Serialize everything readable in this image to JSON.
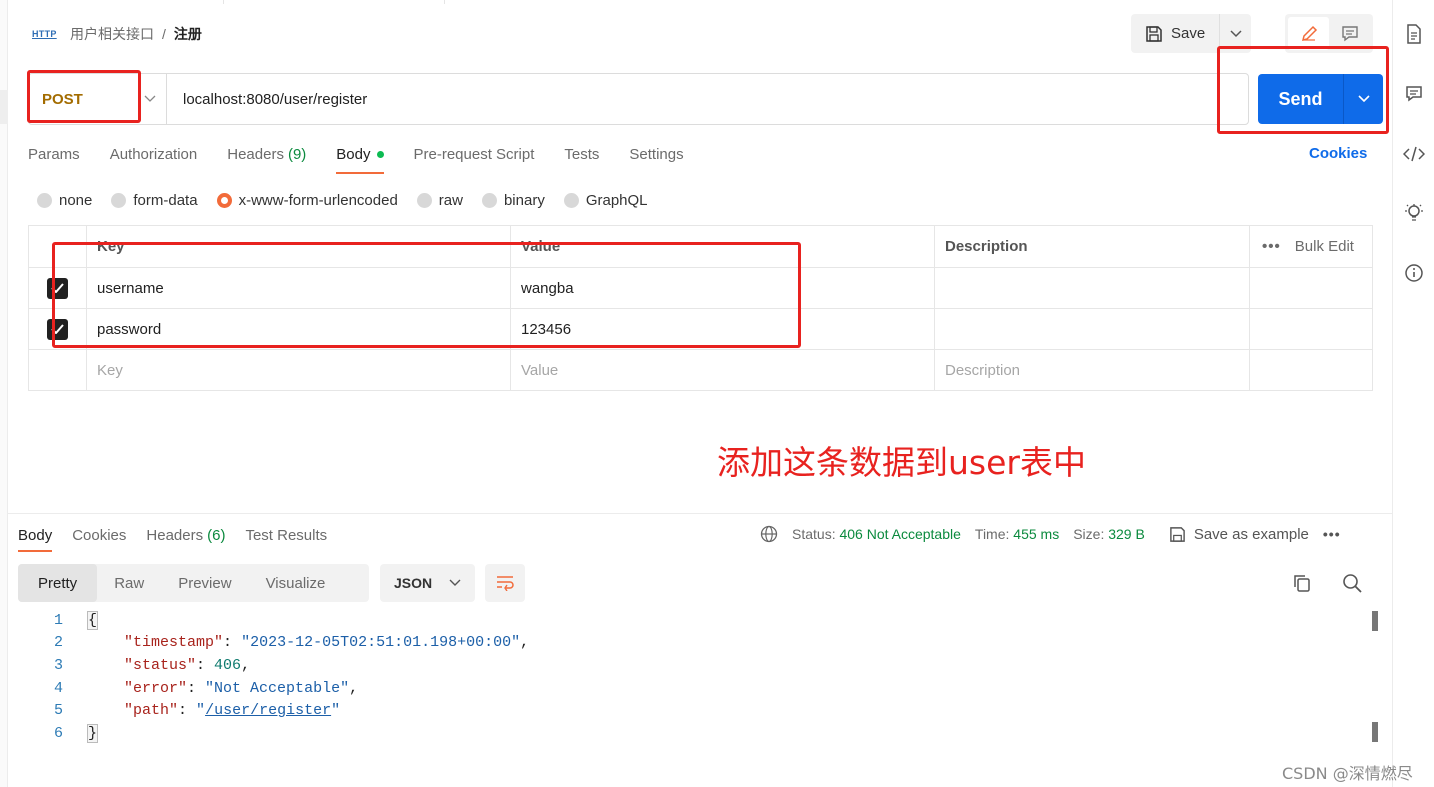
{
  "breadcrumb": {
    "icon": "HTTP",
    "parent": "用户相关接口",
    "separator": "/",
    "current": "注册"
  },
  "toolbar": {
    "save_label": "Save"
  },
  "request": {
    "method": "POST",
    "url": "localhost:8080/user/register",
    "send_label": "Send"
  },
  "tabs": [
    {
      "label": "Params"
    },
    {
      "label": "Authorization"
    },
    {
      "label": "Headers",
      "count": "(9)"
    },
    {
      "label": "Body"
    },
    {
      "label": "Pre-request Script"
    },
    {
      "label": "Tests"
    },
    {
      "label": "Settings"
    }
  ],
  "cookies_label": "Cookies",
  "body_types": [
    "none",
    "form-data",
    "x-www-form-urlencoded",
    "raw",
    "binary",
    "GraphQL"
  ],
  "body_type_selected": "x-www-form-urlencoded",
  "table": {
    "headers": {
      "key": "Key",
      "value": "Value",
      "description": "Description",
      "bulk_edit": "Bulk Edit"
    },
    "rows": [
      {
        "key": "username",
        "value": "wangba",
        "checked": true
      },
      {
        "key": "password",
        "value": "123456",
        "checked": true
      }
    ],
    "placeholders": {
      "key": "Key",
      "value": "Value",
      "description": "Description"
    }
  },
  "annotation": "添加这条数据到user表中",
  "response": {
    "tabs": [
      {
        "label": "Body"
      },
      {
        "label": "Cookies"
      },
      {
        "label": "Headers",
        "count": "(6)"
      },
      {
        "label": "Test Results"
      }
    ],
    "status_label": "Status:",
    "status_value": "406 Not Acceptable",
    "time_label": "Time:",
    "time_value": "455 ms",
    "size_label": "Size:",
    "size_value": "329 B",
    "save_example_label": "Save as example",
    "formats": [
      "Pretty",
      "Raw",
      "Preview",
      "Visualize"
    ],
    "format_selected": "Pretty",
    "language": "JSON"
  },
  "code_lines": [
    "1",
    "2",
    "3",
    "4",
    "5",
    "6"
  ],
  "json_body": {
    "timestamp_key": "\"timestamp\"",
    "timestamp_val": "\"2023-12-05T02:51:01.198+00:00\"",
    "status_key": "\"status\"",
    "status_val": "406",
    "error_key": "\"error\"",
    "error_val": "\"Not Acceptable\"",
    "path_key": "\"path\"",
    "path_val": "/user/register"
  },
  "watermark": "CSDN @深情燃尽",
  "colors": {
    "accent": "#f26b3a",
    "send": "#0f6be9",
    "method": "#a36c00",
    "annotation": "#e8221f",
    "status_ok": "#0b8a3e"
  }
}
